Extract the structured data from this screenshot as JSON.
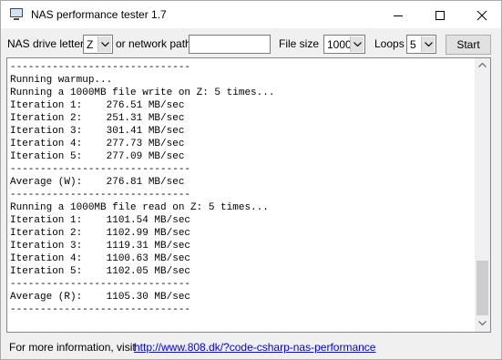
{
  "window": {
    "title": "NAS performance tester 1.7",
    "icon": "monitor-icon"
  },
  "titlebar_buttons": {
    "minimize_icon": "minimize-icon",
    "maximize_icon": "maximize-icon",
    "close_icon": "close-icon"
  },
  "toolbar": {
    "drive_letter_label": "NAS drive letter",
    "drive_letter_value": "Z",
    "network_path_label": "or network path",
    "network_path_value": "",
    "file_size_label": "File size",
    "file_size_value": "1000",
    "loops_label": "Loops",
    "loops_value": "5",
    "start_label": "Start"
  },
  "log": {
    "text": "------------------------------\nRunning warmup...\nRunning a 1000MB file write on Z: 5 times...\nIteration 1:    276.51 MB/sec\nIteration 2:    251.31 MB/sec\nIteration 3:    301.41 MB/sec\nIteration 4:    277.73 MB/sec\nIteration 5:    277.09 MB/sec\n------------------------------\nAverage (W):    276.81 MB/sec\n------------------------------\nRunning a 1000MB file read on Z: 5 times...\nIteration 1:    1101.54 MB/sec\nIteration 2:    1102.99 MB/sec\nIteration 3:    1119.31 MB/sec\nIteration 4:    1100.63 MB/sec\nIteration 5:    1102.05 MB/sec\n------------------------------\nAverage (R):    1105.30 MB/sec\n------------------------------"
  },
  "footer": {
    "info_label": "For more information, visit",
    "link_text": "http://www.808.dk/?code-csharp-nas-performance"
  },
  "colors": {
    "window_bg": "#f0f0f0",
    "link": "#0000ee",
    "scroll_thumb": "#cdcdcd"
  }
}
